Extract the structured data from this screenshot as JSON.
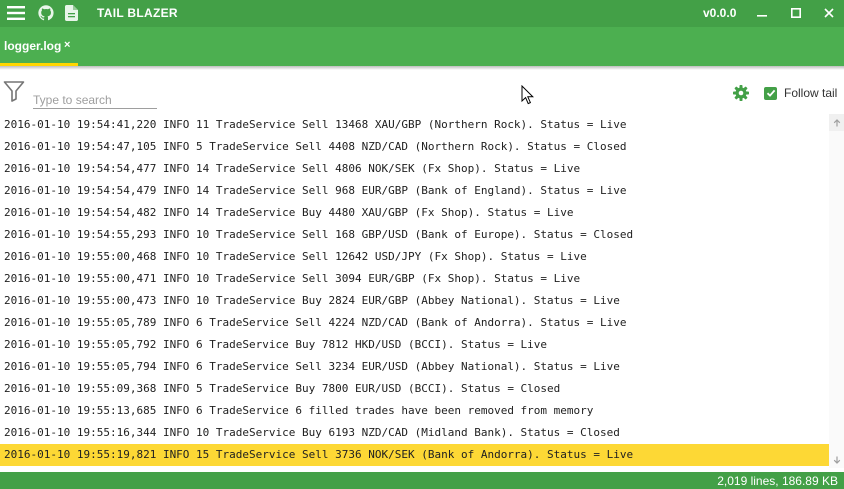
{
  "window": {
    "title": "TAIL BLAZER",
    "version": "v0.0.0",
    "colors": {
      "primary": "#43a047",
      "tab_strip": "#4caf50",
      "accent": "#ffd600",
      "highlight": "#fdd835"
    }
  },
  "tabs": [
    {
      "label": "logger.log",
      "close": "×"
    }
  ],
  "toolbar": {
    "search_placeholder": "Type to search",
    "follow_tail_label": "Follow tail",
    "follow_tail_checked": true
  },
  "log": {
    "lines": [
      "2016-01-10 19:54:41,220 INFO 11 TradeService Sell 13468 XAU/GBP (Northern Rock). Status = Live",
      "2016-01-10 19:54:47,105 INFO 5 TradeService Sell 4408 NZD/CAD (Northern Rock). Status = Closed",
      "2016-01-10 19:54:54,477 INFO 14 TradeService Sell 4806 NOK/SEK (Fx Shop). Status = Live",
      "2016-01-10 19:54:54,479 INFO 14 TradeService Sell 968 EUR/GBP (Bank of England). Status = Live",
      "2016-01-10 19:54:54,482 INFO 14 TradeService Buy 4480 XAU/GBP (Fx Shop). Status = Live",
      "2016-01-10 19:54:55,293 INFO 10 TradeService Sell 168 GBP/USD (Bank of Europe). Status = Closed",
      "2016-01-10 19:55:00,468 INFO 10 TradeService Sell 12642 USD/JPY (Fx Shop). Status = Live",
      "2016-01-10 19:55:00,471 INFO 10 TradeService Sell 3094 EUR/GBP (Fx Shop). Status = Live",
      "2016-01-10 19:55:00,473 INFO 10 TradeService Buy 2824 EUR/GBP (Abbey National). Status = Live",
      "2016-01-10 19:55:05,789 INFO 6 TradeService Sell 4224 NZD/CAD (Bank of Andorra). Status = Live",
      "2016-01-10 19:55:05,792 INFO 6 TradeService Buy 7812 HKD/USD (BCCI). Status = Live",
      "2016-01-10 19:55:05,794 INFO 6 TradeService Sell 3234 EUR/USD (Abbey National). Status = Live",
      "2016-01-10 19:55:09,368 INFO 5 TradeService Buy 7800 EUR/USD (BCCI). Status = Closed",
      "2016-01-10 19:55:13,685 INFO 6 TradeService 6 filled trades have been removed from memory",
      "2016-01-10 19:55:16,344 INFO 10 TradeService Buy 6193 NZD/CAD (Midland Bank). Status = Closed",
      "2016-01-10 19:55:19,821 INFO 15 TradeService Sell 3736 NOK/SEK (Bank of Andorra). Status = Live"
    ],
    "highlighted_index": 15
  },
  "status": {
    "text": "2,019 lines, 186.89 KB"
  }
}
